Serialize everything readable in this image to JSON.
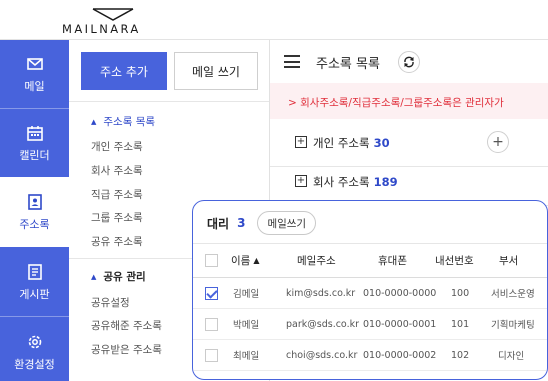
{
  "brand": {
    "logo_text": "MAILNARA",
    "accent": "#4863dc",
    "alert_color": "#e0303c"
  },
  "left_nav": {
    "items": [
      {
        "label": "메일",
        "icon": "mail-icon"
      },
      {
        "label": "캘린더",
        "icon": "calendar-icon"
      },
      {
        "label": "주소록",
        "icon": "contacts-icon",
        "active": true
      },
      {
        "label": "게시판",
        "icon": "board-icon"
      },
      {
        "label": "환경설정",
        "icon": "settings-icon"
      }
    ]
  },
  "sidebar": {
    "add_contact_label": "주소 추가",
    "write_mail_label": "메일 쓰기",
    "address_section": {
      "title": "주소록 목록",
      "items": [
        "개인 주소록",
        "회사 주소록",
        "직급 주소록",
        "그룹 주소록",
        "공유 주소록"
      ]
    },
    "share_section": {
      "title": "공유 관리",
      "items": [
        "공유설정",
        "공유해준 주소록",
        "공유받은 주소록"
      ]
    }
  },
  "main": {
    "title": "주소록 목록",
    "notice": "> 회사주소록/직급주소록/그룹주소록은 관리자가",
    "groups": [
      {
        "label": "개인 주소록",
        "count": "30",
        "expand_symbol": "+"
      },
      {
        "label": "회사 주소록",
        "count": "189",
        "expand_symbol": "+"
      }
    ],
    "add_symbol": "+"
  },
  "popup": {
    "title": "대리",
    "count": "3",
    "write_mail_label": "메일쓰기",
    "columns": {
      "name": "이름",
      "email": "메일주소",
      "phone": "휴대폰",
      "ext": "내선번호",
      "dept": "부서"
    },
    "rows": [
      {
        "checked": true,
        "name": "김메일",
        "email": "kim@sds.co.kr",
        "phone": "010-0000-0000",
        "ext": "100",
        "dept": "서비스운영"
      },
      {
        "checked": false,
        "name": "박메일",
        "email": "park@sds.co.kr",
        "phone": "010-0000-0001",
        "ext": "101",
        "dept": "기획마케팅"
      },
      {
        "checked": false,
        "name": "최메일",
        "email": "choi@sds.co.kr",
        "phone": "010-0000-0002",
        "ext": "102",
        "dept": "디자인"
      }
    ]
  }
}
